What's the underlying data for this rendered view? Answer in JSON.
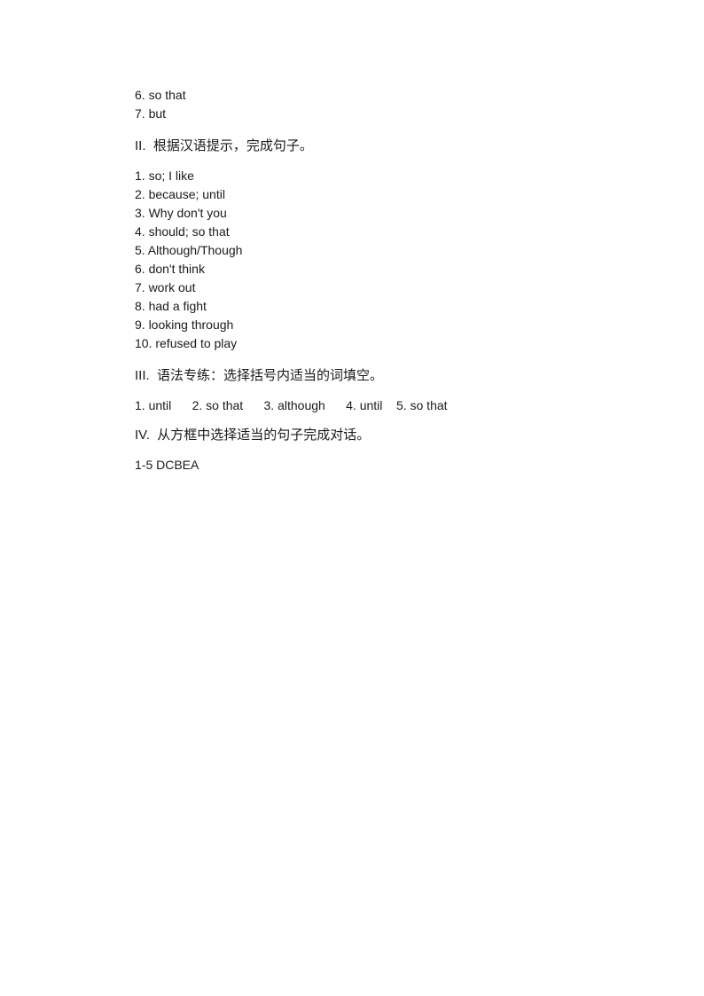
{
  "document": {
    "background_color": "#ffffff",
    "text_color": "#1a1a1a"
  },
  "sections": {
    "part_one_tail": {
      "answers": [
        "6. so that",
        "7. but"
      ]
    },
    "part_two": {
      "heading": "II.  根据汉语提示，完成句子。",
      "answers": [
        "1. so; I like",
        "2. because; until",
        "3. Why don't you",
        "4. should; so that",
        "5. Although/Though",
        "6. don't think",
        "7. work out",
        "8. had a fight",
        "9. looking through",
        "10. refused to play"
      ]
    },
    "part_three": {
      "heading": "III.  语法专练：选择括号内适当的词填空。",
      "answers_line": "1. until      2. so that      3. although      4. until    5. so that"
    },
    "part_four": {
      "heading": "IV.  从方框中选择适当的句子完成对话。",
      "answers_line": "1-5 DCBEA"
    }
  }
}
